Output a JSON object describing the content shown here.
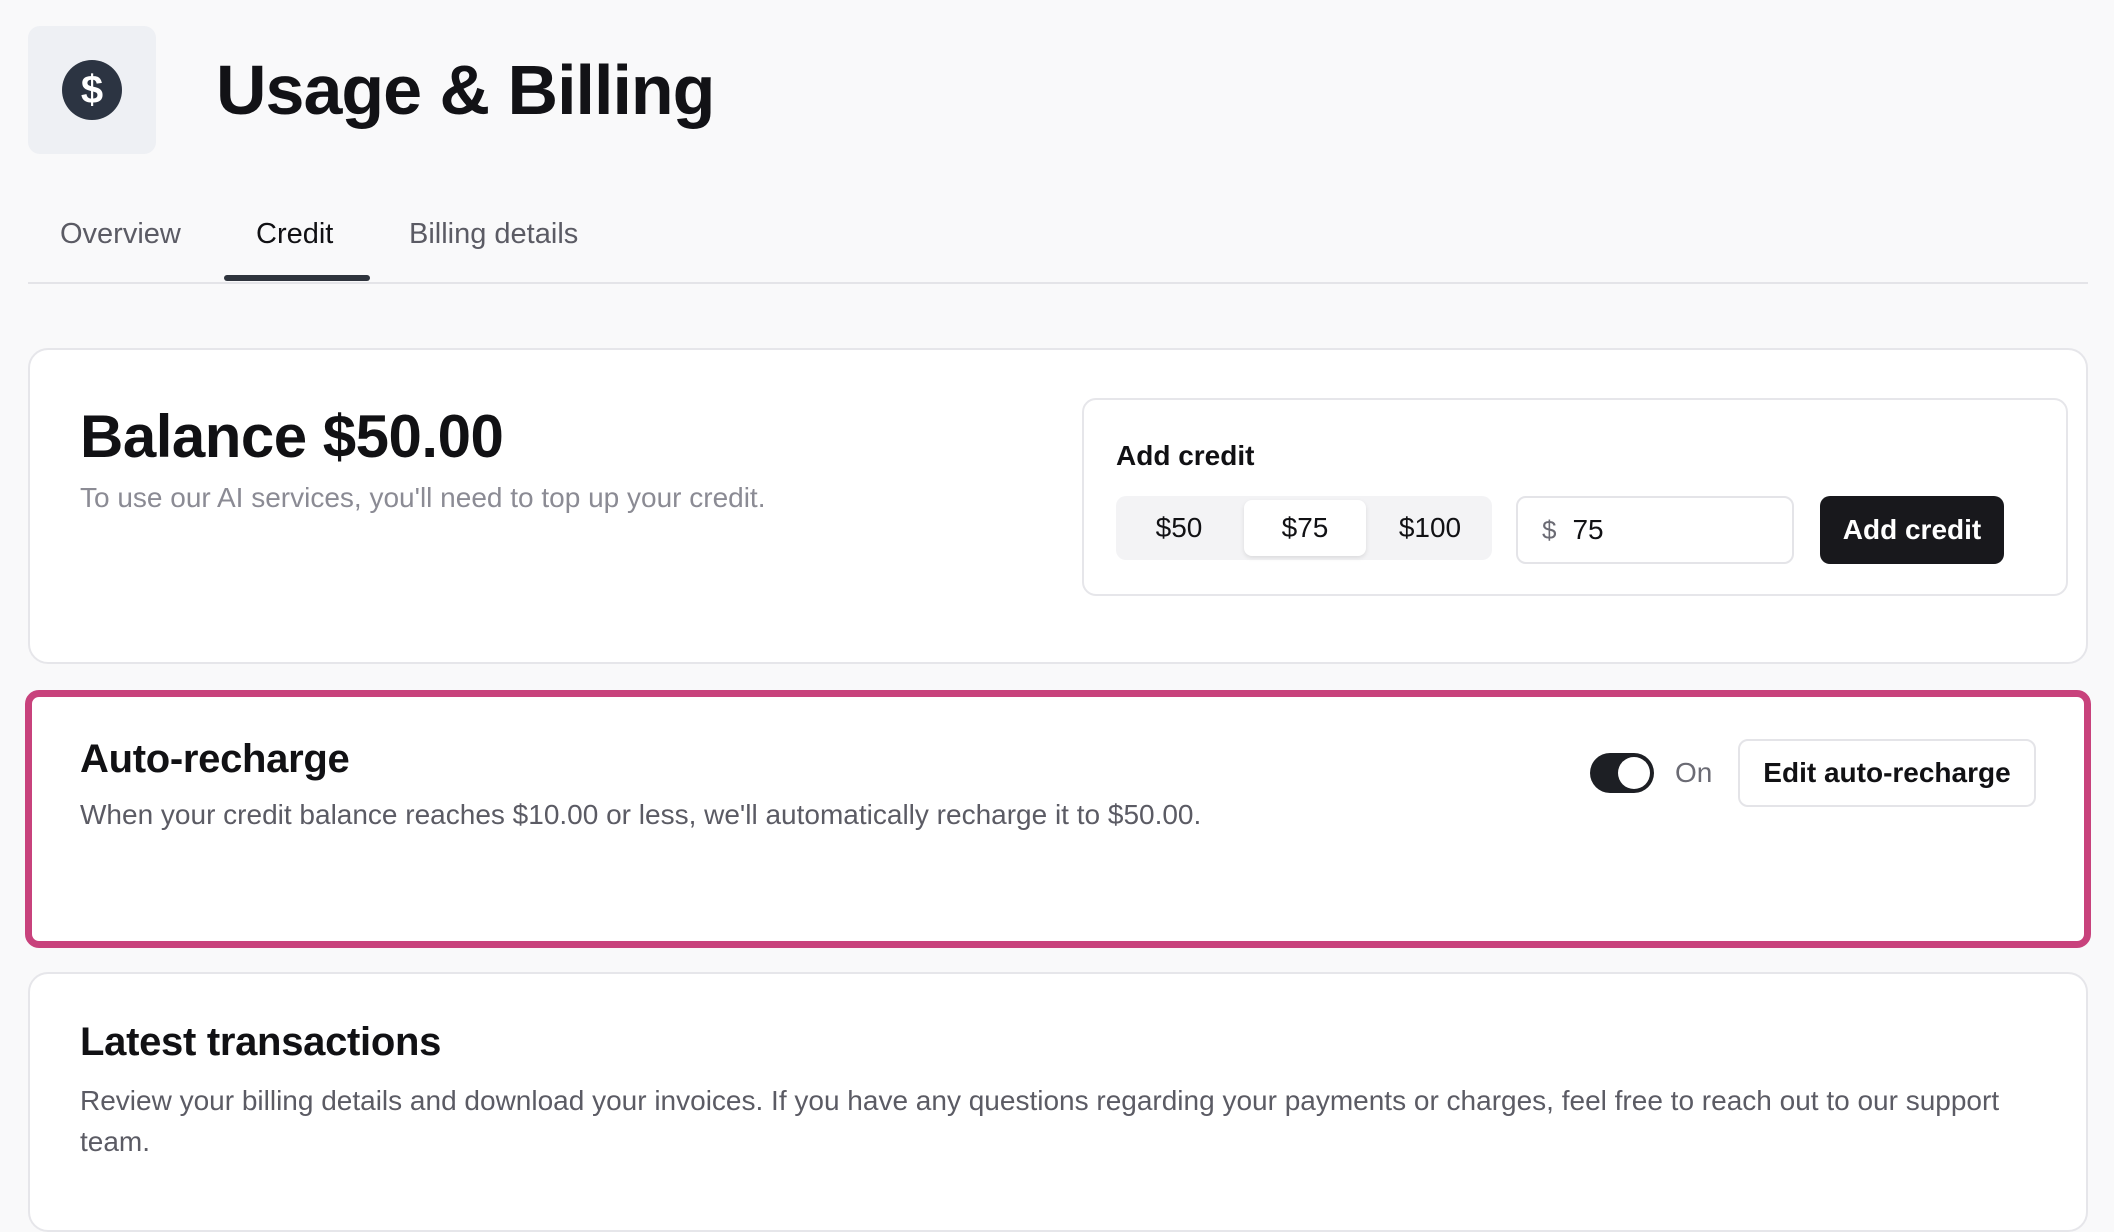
{
  "header": {
    "title": "Usage & Billing",
    "icon": "dollar-circle-icon",
    "icon_glyph": "$"
  },
  "tabs": [
    {
      "label": "Overview",
      "active": false
    },
    {
      "label": "Credit",
      "active": true
    },
    {
      "label": "Billing details",
      "active": false
    }
  ],
  "balance": {
    "title": "Balance $50.00",
    "description": "To use our AI services, you'll need to top up your credit."
  },
  "add_credit": {
    "label": "Add credit",
    "options": [
      "$50",
      "$75",
      "$100"
    ],
    "selected_option": "$75",
    "currency_symbol": "$",
    "amount_value": "75",
    "button_label": "Add credit"
  },
  "auto_recharge": {
    "title": "Auto-recharge",
    "description": "When your credit balance reaches $10.00 or less, we'll automatically recharge it to $50.00.",
    "toggle_on": true,
    "toggle_label": "On",
    "edit_button_label": "Edit auto-recharge",
    "highlight_color": "#c8427c"
  },
  "latest_transactions": {
    "title": "Latest transactions",
    "description": "Review your billing details and download your invoices. If you have any questions regarding your payments or charges, feel free to reach out to our support team."
  },
  "colors": {
    "background": "#f9f9fa",
    "primary_button": "#18181c",
    "icon_circle": "#2c3442"
  }
}
